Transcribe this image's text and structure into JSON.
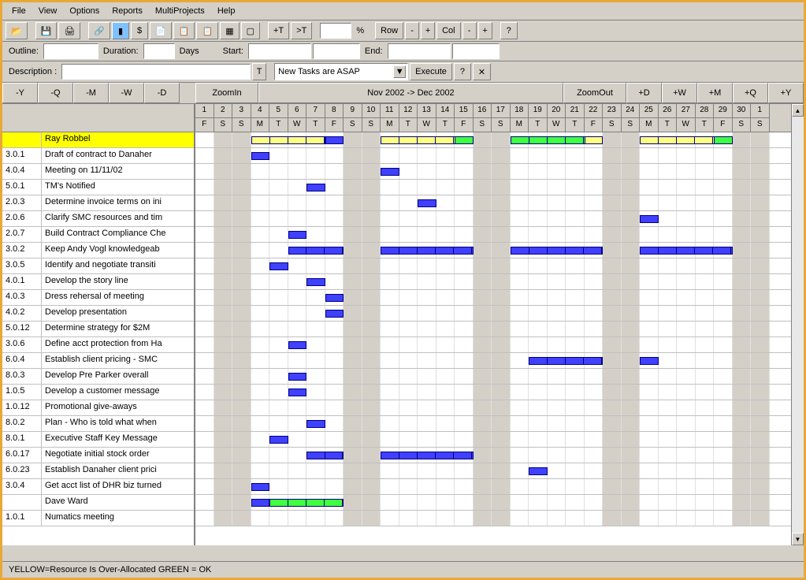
{
  "menu": [
    "File",
    "View",
    "Options",
    "Reports",
    "MultiProjects",
    "Help"
  ],
  "toolbar2": {
    "outline_label": "Outline:",
    "duration_label": "Duration:",
    "days_label": "Days",
    "start_label": "Start:",
    "end_label": "End:",
    "desc_label": "Description :",
    "combo_value": "New Tasks are ASAP",
    "execute": "Execute",
    "percent": "%",
    "row": "Row",
    "col": "Col"
  },
  "nav": {
    "back": [
      "-Y",
      "-Q",
      "-M",
      "-W",
      "-D"
    ],
    "zoomin": "ZoomIn",
    "center": "Nov 2002 -> Dec 2002",
    "zoomout": "ZoomOut",
    "fwd": [
      "+D",
      "+W",
      "+M",
      "+Q",
      "+Y"
    ]
  },
  "days": {
    "nums": [
      1,
      2,
      3,
      4,
      5,
      6,
      7,
      8,
      9,
      10,
      11,
      12,
      13,
      14,
      15,
      16,
      17,
      18,
      19,
      20,
      21,
      22,
      23,
      24,
      25,
      26,
      27,
      28,
      29,
      30,
      1
    ],
    "letters": [
      "F",
      "S",
      "S",
      "M",
      "T",
      "W",
      "T",
      "F",
      "S",
      "S",
      "M",
      "T",
      "W",
      "T",
      "F",
      "S",
      "S",
      "M",
      "T",
      "W",
      "T",
      "F",
      "S",
      "S",
      "M",
      "T",
      "W",
      "T",
      "F",
      "S",
      "S"
    ],
    "weekends": [
      1,
      2,
      8,
      9,
      15,
      16,
      22,
      23,
      29,
      30
    ]
  },
  "tasks": [
    {
      "id": "",
      "name": "Ray Robbel",
      "hl": true,
      "bars": [
        {
          "s": 3,
          "e": 7,
          "c": "yellow",
          "seg": true
        },
        {
          "s": 7,
          "e": 8,
          "c": "blue"
        },
        {
          "s": 10,
          "e": 15,
          "c": "yellow",
          "seg": true
        },
        {
          "s": 14,
          "e": 15,
          "c": "green"
        },
        {
          "s": 17,
          "e": 22,
          "c": "green",
          "seg": true
        },
        {
          "s": 21,
          "e": 22,
          "c": "yellow"
        },
        {
          "s": 24,
          "e": 29,
          "c": "yellow",
          "seg": true
        },
        {
          "s": 28,
          "e": 29,
          "c": "green"
        }
      ]
    },
    {
      "id": "3.0.1",
      "name": "Draft of contract to Danaher",
      "bars": [
        {
          "s": 3,
          "e": 4,
          "c": "blue"
        }
      ]
    },
    {
      "id": "4.0.4",
      "name": "Meeting on 11/11/02",
      "bars": [
        {
          "s": 10,
          "e": 11,
          "c": "blue"
        }
      ]
    },
    {
      "id": "5.0.1",
      "name": "TM's Notified",
      "bars": [
        {
          "s": 6,
          "e": 7,
          "c": "blue"
        }
      ]
    },
    {
      "id": "2.0.3",
      "name": "Determine invoice terms on ini",
      "bars": [
        {
          "s": 12,
          "e": 13,
          "c": "blue"
        }
      ]
    },
    {
      "id": "2.0.6",
      "name": "Clarify SMC resources and tim",
      "bars": [
        {
          "s": 24,
          "e": 25,
          "c": "blue"
        }
      ]
    },
    {
      "id": "2.0.7",
      "name": "Build Contract Compliance Che",
      "bars": [
        {
          "s": 5,
          "e": 6,
          "c": "blue"
        }
      ]
    },
    {
      "id": "3.0.2",
      "name": "Keep Andy Vogl knowledgeab",
      "bars": [
        {
          "s": 5,
          "e": 8,
          "c": "blue",
          "seg": true
        },
        {
          "s": 10,
          "e": 15,
          "c": "blue",
          "seg": true
        },
        {
          "s": 17,
          "e": 22,
          "c": "blue",
          "seg": true
        },
        {
          "s": 24,
          "e": 29,
          "c": "blue",
          "seg": true
        }
      ]
    },
    {
      "id": "3.0.5",
      "name": "Identify and negotiate transiti",
      "bars": [
        {
          "s": 4,
          "e": 5,
          "c": "blue"
        }
      ]
    },
    {
      "id": "4.0.1",
      "name": "Develop the story line",
      "bars": [
        {
          "s": 6,
          "e": 7,
          "c": "blue"
        }
      ]
    },
    {
      "id": "4.0.3",
      "name": "Dress rehersal of meeting",
      "bars": [
        {
          "s": 7,
          "e": 8,
          "c": "blue"
        }
      ]
    },
    {
      "id": "4.0.2",
      "name": "Develop presentation",
      "bars": [
        {
          "s": 7,
          "e": 8,
          "c": "blue"
        }
      ]
    },
    {
      "id": "5.0.12",
      "name": "Determine strategy for $2M",
      "bars": []
    },
    {
      "id": "3.0.6",
      "name": "Define acct protection from Ha",
      "bars": [
        {
          "s": 5,
          "e": 6,
          "c": "blue"
        }
      ]
    },
    {
      "id": "6.0.4",
      "name": "Establish client pricing - SMC",
      "bars": [
        {
          "s": 18,
          "e": 22,
          "c": "blue",
          "seg": true
        },
        {
          "s": 24,
          "e": 25,
          "c": "blue"
        }
      ]
    },
    {
      "id": "8.0.3",
      "name": "Develop Pre Parker overall",
      "bars": [
        {
          "s": 5,
          "e": 6,
          "c": "blue"
        }
      ]
    },
    {
      "id": "1.0.5",
      "name": "Develop a customer message",
      "bars": [
        {
          "s": 5,
          "e": 6,
          "c": "blue"
        }
      ]
    },
    {
      "id": "1.0.12",
      "name": "Promotional give-aways",
      "bars": []
    },
    {
      "id": "8.0.2",
      "name": "Plan - Who is told what when",
      "bars": [
        {
          "s": 6,
          "e": 7,
          "c": "blue"
        }
      ]
    },
    {
      "id": "8.0.1",
      "name": "Executive Staff Key Message",
      "bars": [
        {
          "s": 4,
          "e": 5,
          "c": "blue"
        }
      ]
    },
    {
      "id": "6.0.17",
      "name": "Negotiate initial stock order",
      "bars": [
        {
          "s": 6,
          "e": 8,
          "c": "blue",
          "seg": true
        },
        {
          "s": 10,
          "e": 15,
          "c": "blue",
          "seg": true
        }
      ]
    },
    {
      "id": "6.0.23",
      "name": "Establish Danaher client prici",
      "bars": [
        {
          "s": 18,
          "e": 19,
          "c": "blue"
        }
      ]
    },
    {
      "id": "3.0.4",
      "name": "Get acct list of DHR biz turned",
      "bars": [
        {
          "s": 3,
          "e": 4,
          "c": "blue"
        }
      ]
    },
    {
      "id": "",
      "name": "Dave Ward",
      "bars": [
        {
          "s": 3,
          "e": 4,
          "c": "blue"
        },
        {
          "s": 4,
          "e": 8,
          "c": "green",
          "seg": true
        }
      ]
    },
    {
      "id": "1.0.1",
      "name": "Numatics meeting",
      "bars": []
    }
  ],
  "status": "YELLOW=Resource Is Over-Allocated   GREEN = OK"
}
